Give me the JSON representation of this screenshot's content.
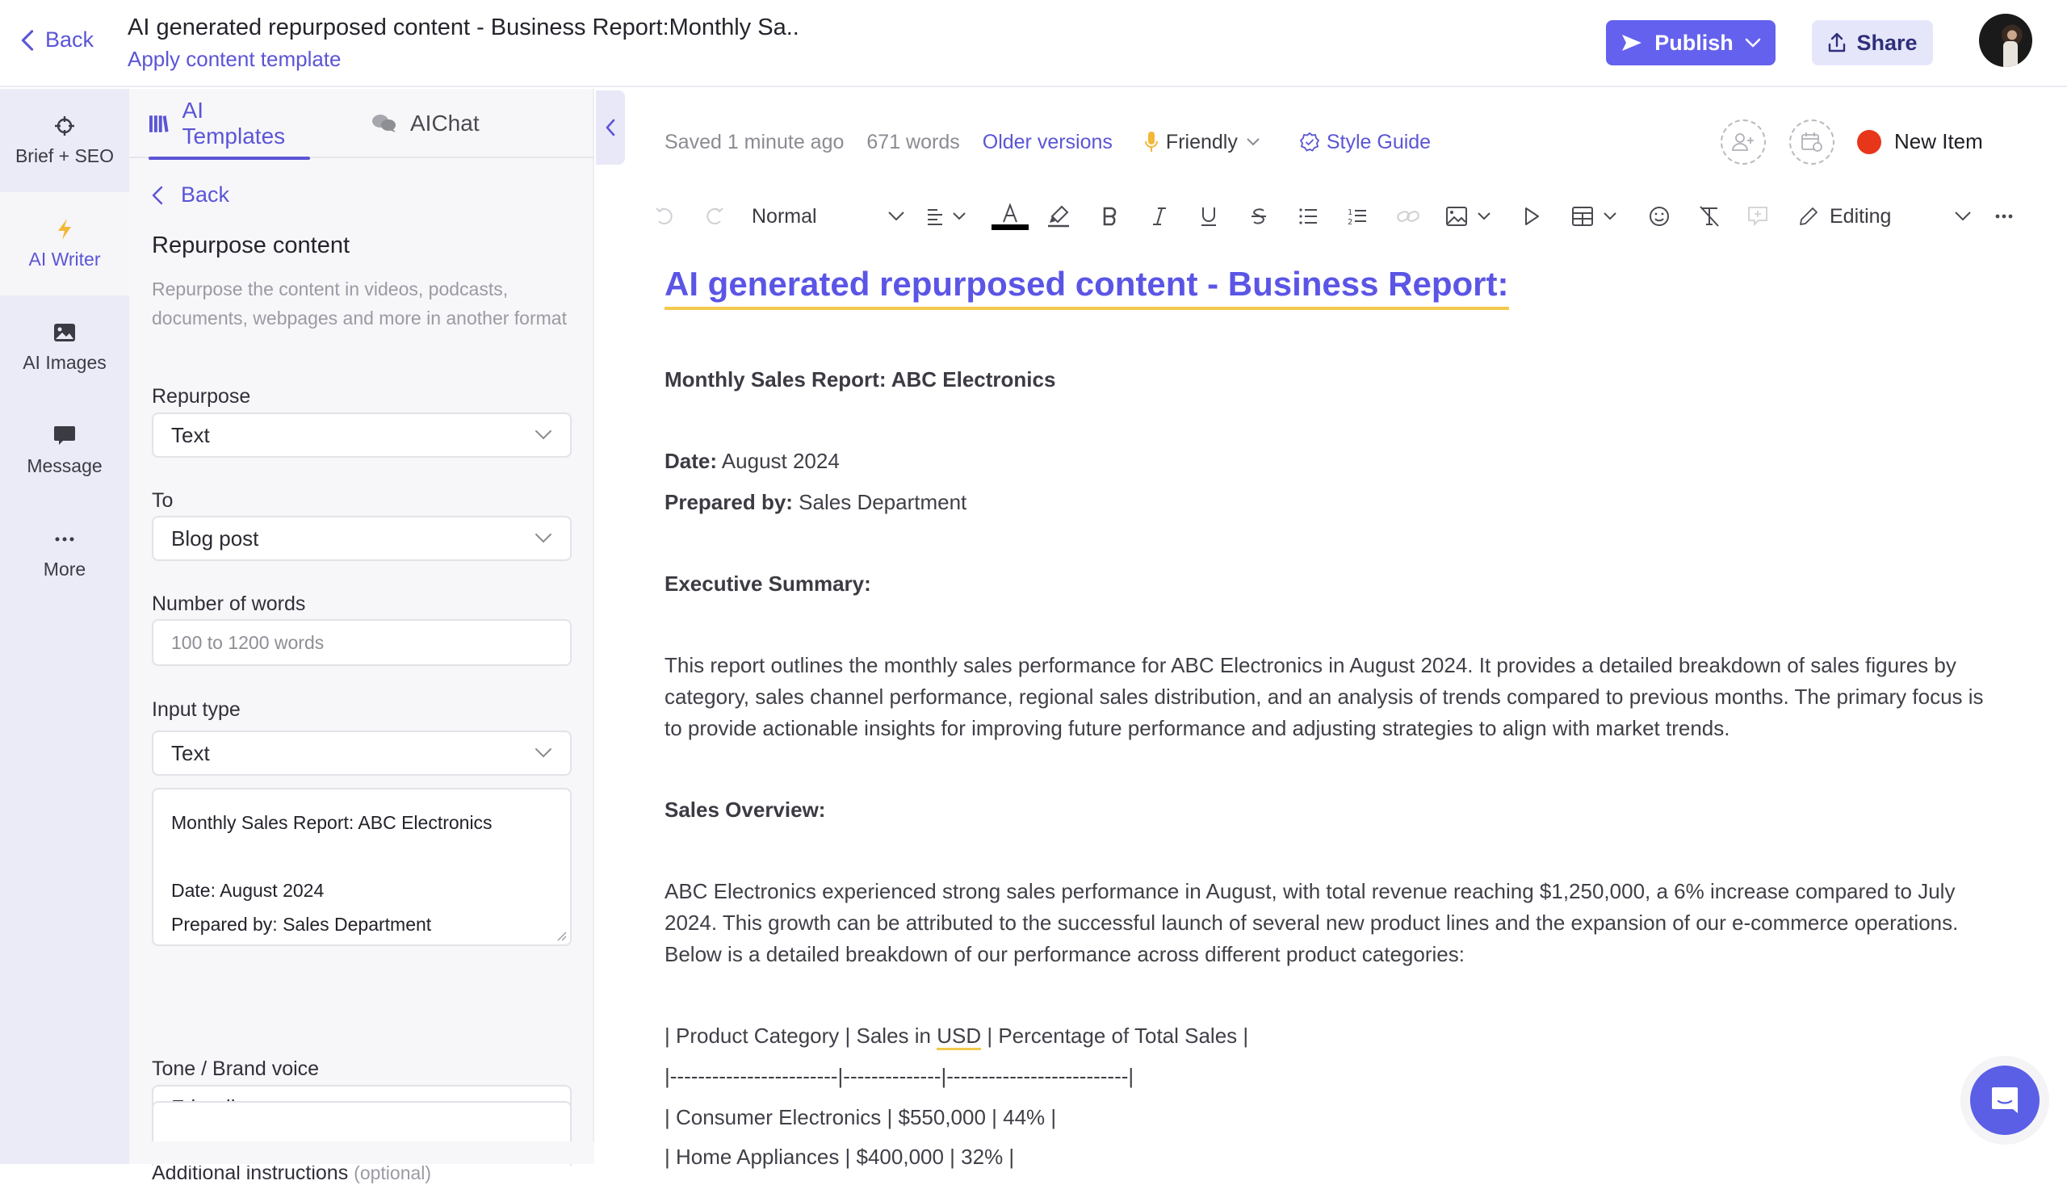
{
  "header": {
    "back_label": "Back",
    "title": "AI generated repurposed content - Business Report:Monthly Sa..",
    "apply_template_label": "Apply content template",
    "publish_label": "Publish",
    "share_label": "Share"
  },
  "rail": {
    "items": [
      {
        "label": "Brief + SEO",
        "icon": "crosshair-icon",
        "active": false
      },
      {
        "label": "AI Writer",
        "icon": "lightning-icon",
        "active": true
      },
      {
        "label": "AI Images",
        "icon": "image-icon",
        "active": false
      },
      {
        "label": "Message",
        "icon": "speech-bubble-icon",
        "active": false
      },
      {
        "label": "More",
        "icon": "more-dots-icon",
        "active": false
      }
    ]
  },
  "panel": {
    "tabs": [
      {
        "label": "AI Templates",
        "icon": "library-icon",
        "active": true
      },
      {
        "label": "AIChat",
        "icon": "chat-bubbles-icon",
        "active": false
      }
    ],
    "back_label": "Back",
    "heading": "Repurpose content",
    "description": "Repurpose the content in videos, podcasts, documents, webpages and more in another format",
    "fields": {
      "repurpose": {
        "label": "Repurpose",
        "value": "Text"
      },
      "to": {
        "label": "To",
        "value": "Blog post"
      },
      "number_of_words": {
        "label": "Number of words",
        "value": "",
        "placeholder": "100 to 1200 words"
      },
      "input_type": {
        "label": "Input type",
        "value": "Text"
      },
      "input_text": {
        "line1": "Monthly Sales Report: ABC Electronics",
        "line2": "",
        "line3": "Date: August 2024",
        "line4": "Prepared by: Sales Department"
      },
      "tone": {
        "label": "Tone / Brand voice",
        "value": "Friendly"
      },
      "additional_instructions": {
        "label": "Additional instructions",
        "optional_label": "(optional)",
        "value": ""
      }
    }
  },
  "status": {
    "saved": "Saved 1 minute ago",
    "word_count": "671 words",
    "older_versions": "Older versions",
    "tone": "Friendly",
    "style_guide": "Style Guide",
    "new_item": "New Item",
    "status_color": "#e8361a"
  },
  "toolbar": {
    "paragraph_style": "Normal",
    "mode": "Editing",
    "text_color": "#000000"
  },
  "document": {
    "title": "AI generated repurposed content - Business Report:",
    "report_title": "Monthly Sales Report: ABC Electronics",
    "date_label": "Date:",
    "date_value": " August 2024",
    "prepared_label": "Prepared by:",
    "prepared_value": " Sales Department",
    "exec_heading": "Executive Summary:",
    "exec_paragraph": "This report outlines the monthly sales performance for ABC Electronics in August 2024. It provides a detailed breakdown of sales figures by category, sales channel performance, regional sales distribution, and an analysis of trends compared to previous months. The primary focus is to provide actionable insights for improving future performance and adjusting strategies to align with market trends.",
    "overview_heading": "Sales Overview:",
    "overview_paragraph": "ABC Electronics experienced strong sales performance in August, with total revenue reaching $1,250,000, a 6% increase compared to July 2024. This growth can be attributed to the successful launch of several new product lines and the expansion of our e-commerce operations. Below is a detailed breakdown of our performance across different product categories:",
    "table_lines": {
      "header_pre": "| Product Category | Sales in ",
      "header_usd": "USD",
      "header_post": " | Percentage of Total Sales |",
      "separator": "|------------------------|--------------|--------------------------|",
      "row1": "| Consumer Electronics | $550,000 | 44% |",
      "row2": "| Home Appliances | $400,000 | 32% |"
    }
  },
  "colors": {
    "accent": "#5b55d6",
    "publish_bg": "#6461ee",
    "share_bg": "#e6e6fb",
    "title_underline": "#f2c94c"
  }
}
